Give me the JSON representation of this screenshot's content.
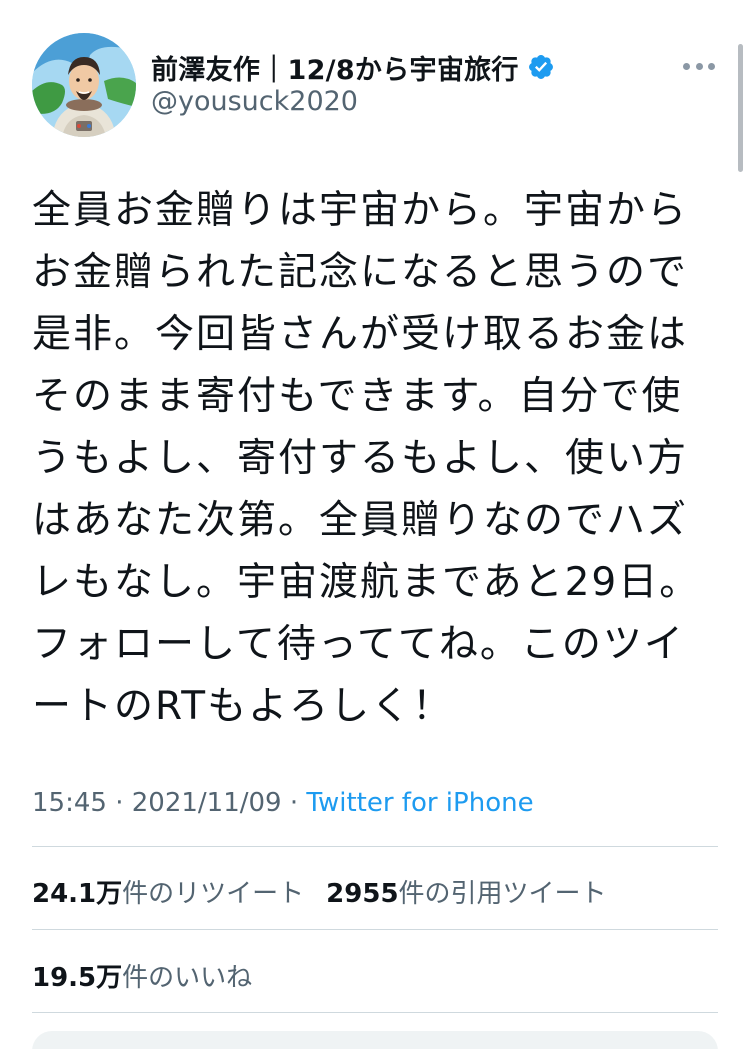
{
  "user": {
    "display_name": "前澤友作｜12/8から宇宙旅行",
    "handle": "@yousuck2020",
    "verified": true,
    "avatar_icon": "astronaut-illustration-avatar"
  },
  "tweet": {
    "lines": [
      "全員お金贈りは宇宙から。宇宙から",
      "お金贈られた記念になると思うので",
      "是非。今回皆さんが受け取るお金は",
      "そのまま寄付もできます。自分で使",
      "うもよし、寄付するもよし、使い方",
      "はあなた次第。全員贈りなのでハズ",
      "レもなし。宇宙渡航まであと29日。",
      "フォローして待っててね。このツイ",
      "ートのRTもよろしく！"
    ]
  },
  "meta": {
    "time": "15:45",
    "separator": " · ",
    "date": "2021/11/09",
    "source": "Twitter for iPhone"
  },
  "stats": {
    "retweets": {
      "count": "24.1万",
      "label": "件のリツイート"
    },
    "quotes": {
      "count": "2955",
      "label": "件の引用ツイート"
    },
    "likes": {
      "count": "19.5万",
      "label": "件のいいね"
    }
  },
  "colors": {
    "link": "#1d9bf0",
    "secondary_text": "#536471",
    "verified_badge": "#1d9bf0",
    "divider": "#cfd9de"
  }
}
